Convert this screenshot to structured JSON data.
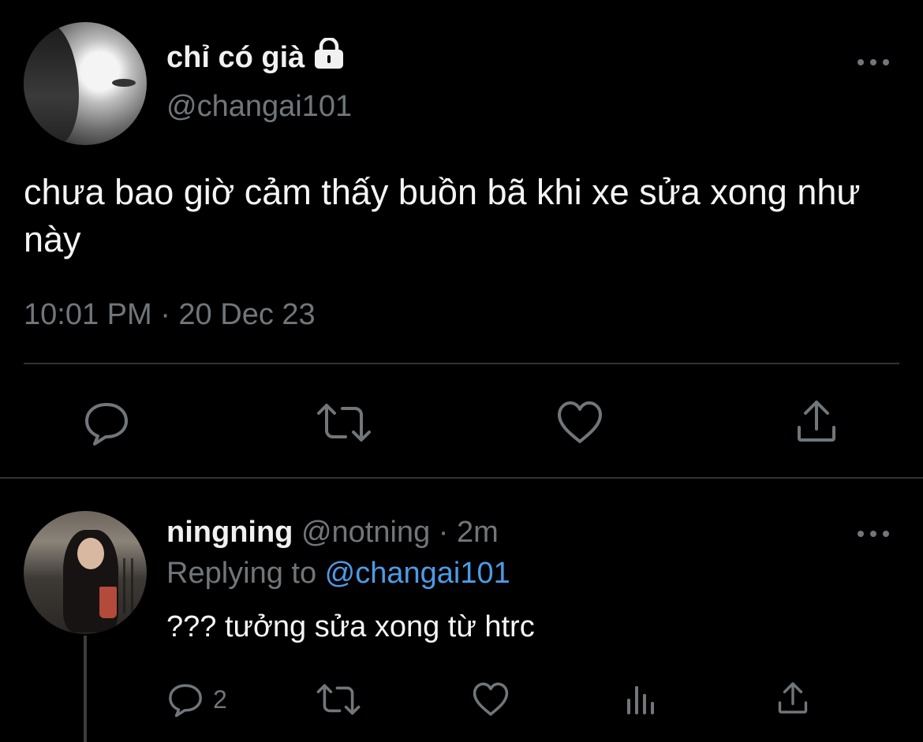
{
  "main_tweet": {
    "display_name": "chỉ có già",
    "protected_icon": "lock-icon",
    "handle": "@changai101",
    "text": "chưa bao giờ cảm thấy buồn bã khi xe sửa xong như này",
    "timestamp": "10:01 PM · 20 Dec 23",
    "actions": [
      "reply-icon",
      "retweet-icon",
      "like-icon",
      "share-icon"
    ]
  },
  "reply_tweet": {
    "display_name": "ningning",
    "handle": "@notning",
    "time_meta": " · 2m",
    "replying_to_prefix": "Replying to ",
    "replying_to_handle": "@changai101",
    "text": "??? tưởng sửa xong từ htrc",
    "reply_count": "2",
    "actions": [
      "reply-icon",
      "retweet-icon",
      "like-icon",
      "views-icon",
      "share-icon"
    ]
  },
  "colors": {
    "background": "#000000",
    "text_primary": "#e7e9ea",
    "text_secondary": "#71767b",
    "mention": "#4d9be6",
    "divider": "#2f3336"
  }
}
